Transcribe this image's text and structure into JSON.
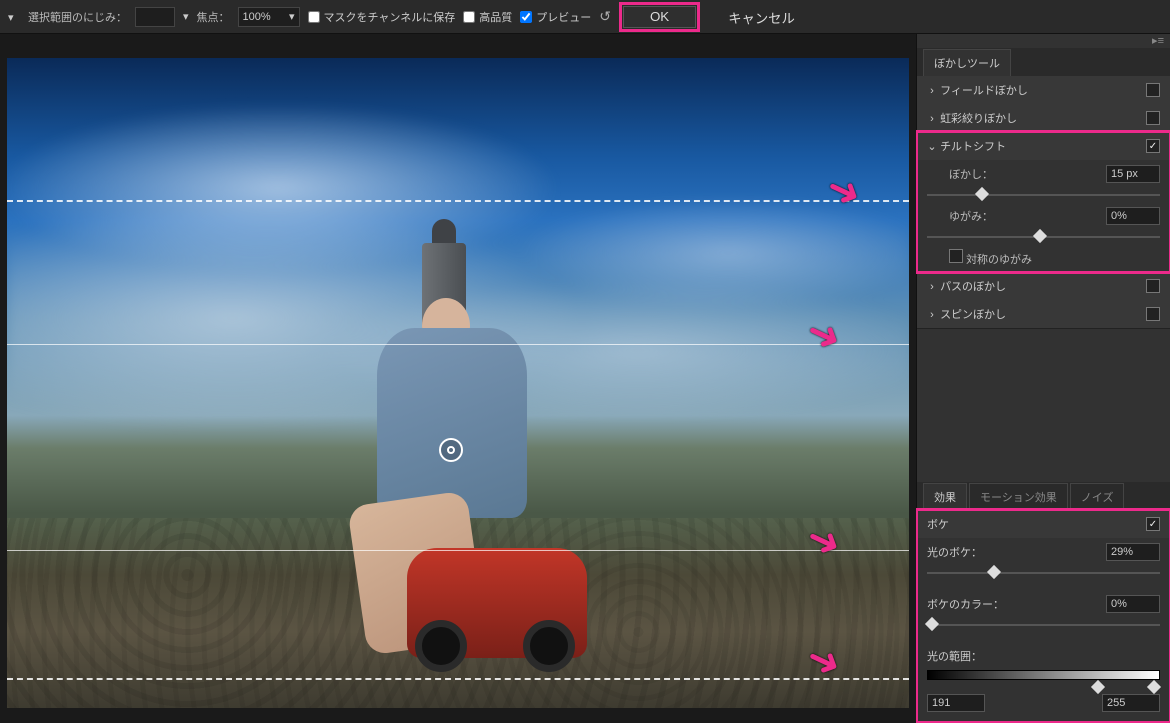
{
  "toolbar": {
    "feather_label": "選択範囲のにじみ：",
    "feather_value": "",
    "focus_label": "焦点：",
    "focus_value": "100%",
    "mask_label": "マスクをチャンネルに保存",
    "hq_label": "高品質",
    "preview_label": "プレビュー",
    "ok": "OK",
    "cancel": "キャンセル"
  },
  "blur_tools": {
    "tab": "ぼかしツール",
    "items": {
      "field": "フィールドぼかし",
      "iris": "虹彩絞りぼかし",
      "tilt": "チルトシフト",
      "path": "パスのぼかし",
      "spin": "スピンぼかし"
    },
    "tilt": {
      "blur_label": "ぼかし：",
      "blur_value": "15 px",
      "distort_label": "ゆがみ：",
      "distort_value": "0%",
      "symmetric_label": "対称のゆがみ"
    }
  },
  "effects": {
    "tabs": {
      "effect": "効果",
      "motion": "モーション効果",
      "noise": "ノイズ"
    },
    "bokeh": {
      "title": "ボケ",
      "light_label": "光のボケ：",
      "light_value": "29%",
      "color_label": "ボケのカラー：",
      "color_value": "0%",
      "range_label": "光の範囲：",
      "range_low": "191",
      "range_high": "255"
    }
  },
  "chart_data": {
    "type": "table",
    "title": "Photoshop Blur Gallery — Tilt-Shift settings",
    "rows": [
      {
        "group": "toolbar",
        "name": "焦点 (Focus)",
        "value": "100%"
      },
      {
        "group": "toolbar",
        "name": "マスクをチャンネルに保存",
        "value": false
      },
      {
        "group": "toolbar",
        "name": "高品質",
        "value": false
      },
      {
        "group": "toolbar",
        "name": "プレビュー",
        "value": true
      },
      {
        "group": "blur_tools",
        "name": "フィールドぼかし enabled",
        "value": false
      },
      {
        "group": "blur_tools",
        "name": "虹彩絞りぼかし enabled",
        "value": false
      },
      {
        "group": "blur_tools",
        "name": "チルトシフト enabled",
        "value": true
      },
      {
        "group": "tilt_shift",
        "name": "ぼかし",
        "value": "15 px"
      },
      {
        "group": "tilt_shift",
        "name": "ゆがみ",
        "value": "0%"
      },
      {
        "group": "tilt_shift",
        "name": "対称のゆがみ",
        "value": false
      },
      {
        "group": "blur_tools",
        "name": "パスのぼかし enabled",
        "value": false
      },
      {
        "group": "blur_tools",
        "name": "スピンぼかし enabled",
        "value": false
      },
      {
        "group": "bokeh",
        "name": "ボケ enabled",
        "value": true
      },
      {
        "group": "bokeh",
        "name": "光のボケ",
        "value": "29%"
      },
      {
        "group": "bokeh",
        "name": "ボケのカラー",
        "value": "0%"
      },
      {
        "group": "bokeh",
        "name": "光の範囲 low",
        "value": 191
      },
      {
        "group": "bokeh",
        "name": "光の範囲 high",
        "value": 255
      }
    ]
  }
}
